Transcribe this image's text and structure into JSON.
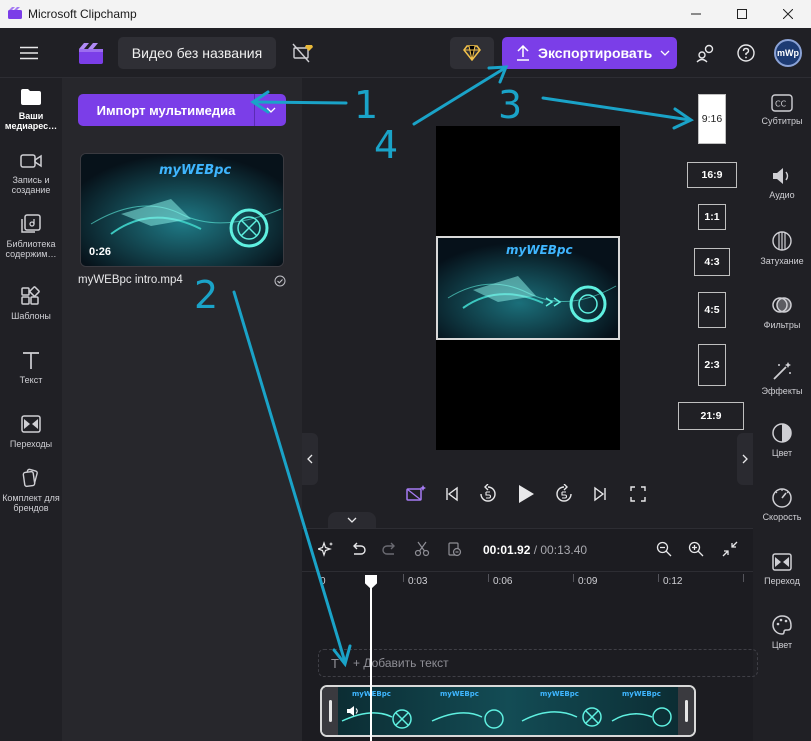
{
  "window": {
    "title": "Microsoft Clipchamp"
  },
  "header": {
    "project_title": "Видео без названия",
    "export_label": "Экспортировать",
    "avatar_initials": "mWp"
  },
  "left_rail": {
    "items": [
      {
        "label": "Ваши медиарес…",
        "icon": "folder-icon"
      },
      {
        "label": "Запись и создание",
        "icon": "video-camera-icon"
      },
      {
        "label": "Библиотека содержим…",
        "icon": "content-library-icon"
      },
      {
        "label": "Шаблоны",
        "icon": "templates-icon"
      },
      {
        "label": "Текст",
        "icon": "text-icon"
      },
      {
        "label": "Переходы",
        "icon": "transitions-icon"
      },
      {
        "label": "Комплект для брендов",
        "icon": "brand-kit-icon"
      }
    ]
  },
  "media": {
    "import_label": "Импорт мультимедиа",
    "item": {
      "name": "myWEBpc intro.mp4",
      "duration": "0:26",
      "thumb_caption": "myWEBpc"
    }
  },
  "preview": {
    "video_caption": "myWEBpc",
    "aspect_ratios": [
      "9:16",
      "16:9",
      "1:1",
      "4:3",
      "4:5",
      "2:3",
      "21:9"
    ],
    "selected_ratio": "9:16"
  },
  "right_rail": {
    "items": [
      {
        "label": "Субтитры",
        "icon": "captions-icon"
      },
      {
        "label": "Аудио",
        "icon": "speaker-icon"
      },
      {
        "label": "Затухание",
        "icon": "fade-icon"
      },
      {
        "label": "Фильтры",
        "icon": "filters-icon"
      },
      {
        "label": "Эффекты",
        "icon": "effects-icon"
      },
      {
        "label": "Цвет",
        "icon": "color-adjust-icon"
      },
      {
        "label": "Скорость",
        "icon": "speed-icon"
      },
      {
        "label": "Переход",
        "icon": "transition-icon"
      },
      {
        "label": "Цвет",
        "icon": "palette-icon"
      }
    ]
  },
  "timeline": {
    "current_time": "00:01.92",
    "total_time": "/ 00:13.40",
    "ruler_ticks": [
      "0",
      "0:03",
      "0:06",
      "0:09",
      "0:12"
    ],
    "add_text_label": "+ Добавить текст",
    "add_text_icon_label": "T"
  },
  "annotations": {
    "labels": [
      "1",
      "2",
      "3",
      "4"
    ],
    "color": "#1aa3c8"
  },
  "colors": {
    "accent": "#7b3ee8",
    "background": "#202025",
    "panel": "#27272c"
  }
}
